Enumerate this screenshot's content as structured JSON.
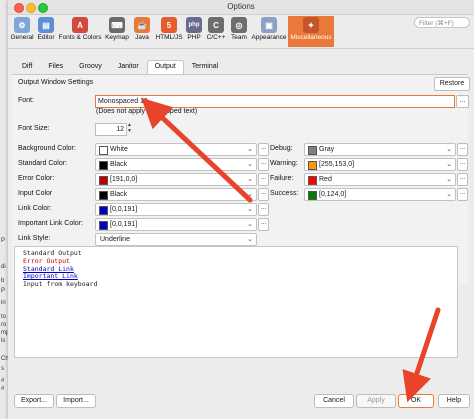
{
  "window": {
    "title": "Options"
  },
  "toolbar": {
    "categories": [
      {
        "label": "General",
        "icon": "general-icon",
        "color": "#7fa6d9",
        "active": false
      },
      {
        "label": "Editor",
        "icon": "editor-icon",
        "color": "#5e8fd4",
        "active": false
      },
      {
        "label": "Fonts & Colors",
        "icon": "fonts-colors-icon",
        "color": "#d24a3a",
        "active": false
      },
      {
        "label": "Keymap",
        "icon": "keymap-icon",
        "color": "#6b6b6b",
        "active": false
      },
      {
        "label": "Java",
        "icon": "java-icon",
        "color": "#e9793b",
        "active": false
      },
      {
        "label": "HTML/JS",
        "icon": "html5-icon",
        "color": "#e65c2f",
        "active": false
      },
      {
        "label": "PHP",
        "icon": "php-icon",
        "color": "#6a6a8f",
        "active": false
      },
      {
        "label": "C/C++",
        "icon": "cpp-icon",
        "color": "#6d6d6d",
        "active": false
      },
      {
        "label": "Team",
        "icon": "team-icon",
        "color": "#6d6d6d",
        "active": false
      },
      {
        "label": "Appearance",
        "icon": "appearance-icon",
        "color": "#8da1c8",
        "active": false
      },
      {
        "label": "Miscellaneous",
        "icon": "miscellaneous-icon",
        "color": "#c7542a",
        "active": true
      }
    ],
    "icon_glyphs": [
      "⚙",
      "▤",
      "A",
      "⌨",
      "☕",
      "5",
      "php",
      "C",
      "◎",
      "▣",
      "✦"
    ],
    "search_placeholder": "Filter (⌘+F)"
  },
  "tabs": [
    "Diff",
    "Files",
    "Groovy",
    "Janitor",
    "Output",
    "Terminal"
  ],
  "active_tab": "Output",
  "output": {
    "section_title": "Output Window Settings",
    "restore_label": "Restore",
    "font_label": "Font:",
    "font_value": "Monospaced 12",
    "font_browse": "...",
    "font_note": "(Does not apply to wrapped text)",
    "font_size_label": "Font Size:",
    "font_size_value": "12",
    "left_rows": [
      {
        "label": "Background Color:",
        "value": "White",
        "swatch": "#ffffff"
      },
      {
        "label": "Standard Color:",
        "value": "Black",
        "swatch": "#000000"
      },
      {
        "label": "Error Color:",
        "value": "[191,0,0]",
        "swatch": "#bf0000"
      },
      {
        "label": "Input Color",
        "value": "Black",
        "swatch": "#000000"
      },
      {
        "label": "Link Color:",
        "value": "[0,0,191]",
        "swatch": "#0000bf"
      },
      {
        "label": "Important Link Color:",
        "value": "[0,0,191]",
        "swatch": "#0000bf"
      },
      {
        "label": "Link Style:",
        "value": "Underline",
        "swatch": ""
      }
    ],
    "right_rows": [
      {
        "label": "Debug:",
        "value": "Gray",
        "swatch": "#808080"
      },
      {
        "label": "Warning:",
        "value": "[255,153,0]",
        "swatch": "#ff9900"
      },
      {
        "label": "Failure:",
        "value": "Red",
        "swatch": "#ff0000"
      },
      {
        "label": "Success:",
        "value": "[0,124,0]",
        "swatch": "#007c00"
      }
    ]
  },
  "preview": {
    "standard": "Standard Output",
    "error": "Error Output",
    "link": "Standard Link",
    "important_link": "Important Link",
    "input": "Input from keyboard"
  },
  "footer": {
    "export": "Export...",
    "import": "Import...",
    "cancel": "Cancel",
    "apply": "Apply",
    "ok": "OK",
    "help": "Help"
  },
  "background_fragments": [
    "P",
    "di",
    "b",
    "P",
    "in",
    "to",
    "ro",
    "mp",
    "ls",
    "Ch",
    "s",
    "#",
    "#"
  ],
  "colors": {
    "accent": "#e9793b",
    "annotation_arrow": "#e8432b"
  }
}
